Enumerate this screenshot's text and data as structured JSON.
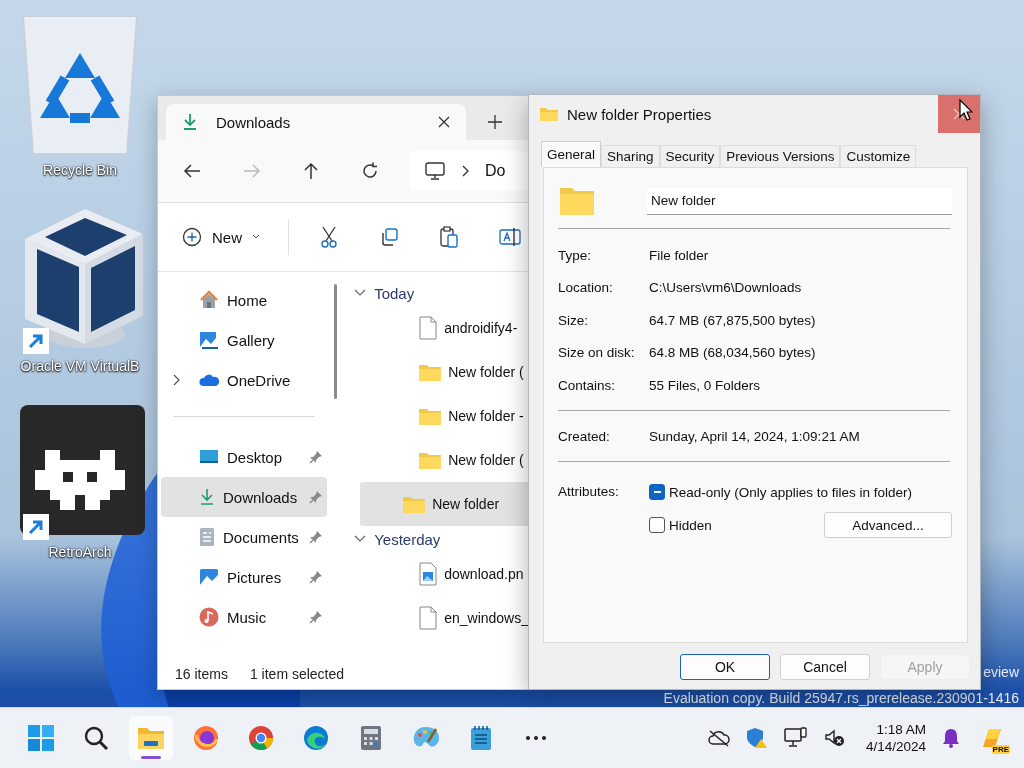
{
  "desktop_icons": [
    {
      "label": "Recycle Bin",
      "kind": "recycle",
      "shortcut": false
    },
    {
      "label": "Oracle VM VirtualB",
      "kind": "virtualbox",
      "shortcut": true
    },
    {
      "label": "RetroArch",
      "kind": "retroarch",
      "shortcut": true
    }
  ],
  "explorer": {
    "tab": {
      "title": "Downloads"
    },
    "address": {
      "crumb": "Do"
    },
    "toolbar": {
      "new_label": "New"
    },
    "sidebar": [
      {
        "items": [
          {
            "label": "Home",
            "kind": "home",
            "pinned": false,
            "selected": false,
            "expandable": false
          },
          {
            "label": "Gallery",
            "kind": "gallery",
            "pinned": false,
            "selected": false,
            "expandable": false
          },
          {
            "label": "OneDrive",
            "kind": "onedrive",
            "pinned": false,
            "selected": false,
            "expandable": true
          }
        ]
      },
      {
        "items": [
          {
            "label": "Desktop",
            "kind": "desktop",
            "pinned": true,
            "selected": false,
            "expandable": false
          },
          {
            "label": "Downloads",
            "kind": "downloads",
            "pinned": true,
            "selected": true,
            "expandable": false
          },
          {
            "label": "Documents",
            "kind": "documents",
            "pinned": true,
            "selected": false,
            "expandable": false
          },
          {
            "label": "Pictures",
            "kind": "pictures",
            "pinned": true,
            "selected": false,
            "expandable": false
          },
          {
            "label": "Music",
            "kind": "music",
            "pinned": true,
            "selected": false,
            "expandable": false
          }
        ]
      }
    ],
    "groups": [
      {
        "label": "Today",
        "expanded": true,
        "items": [
          {
            "name": "androidify4-",
            "kind": "file",
            "selected": false
          },
          {
            "name": "New folder (",
            "kind": "folder",
            "selected": false
          },
          {
            "name": "New folder -",
            "kind": "folder",
            "selected": false
          },
          {
            "name": "New folder (",
            "kind": "folder",
            "selected": false
          },
          {
            "name": "New folder",
            "kind": "folder",
            "selected": true
          }
        ]
      },
      {
        "label": "Yesterday",
        "expanded": true,
        "items": [
          {
            "name": "download.pn",
            "kind": "image",
            "selected": false
          },
          {
            "name": "en_windows_",
            "kind": "file",
            "selected": false
          }
        ]
      }
    ],
    "status": {
      "count": "16 items",
      "selection": "1 item selected"
    }
  },
  "properties": {
    "title": "New folder Properties",
    "tabs": [
      {
        "label": "General",
        "selected": true
      },
      {
        "label": "Sharing",
        "selected": false
      },
      {
        "label": "Security",
        "selected": false
      },
      {
        "label": "Previous Versions",
        "selected": false
      },
      {
        "label": "Customize",
        "selected": false
      }
    ],
    "name_value": "New folder",
    "sections": [
      [
        {
          "label": "Type:",
          "value": "File folder"
        },
        {
          "label": "Location:",
          "value": "C:\\Users\\vm6\\Downloads"
        },
        {
          "label": "Size:",
          "value": "64.7 MB (67,875,500 bytes)"
        },
        {
          "label": "Size on disk:",
          "value": "64.8 MB (68,034,560 bytes)"
        },
        {
          "label": "Contains:",
          "value": "55 Files, 0 Folders"
        }
      ],
      [
        {
          "label": "Created:",
          "value": "Sunday, April 14, 2024, 1:09:21 AM"
        }
      ]
    ],
    "attributes": {
      "label": "Attributes:",
      "checks": [
        {
          "label": "Read-only (Only applies to files in folder)",
          "checked": true,
          "indeterminate": true
        },
        {
          "label": "Hidden",
          "checked": false,
          "indeterminate": false
        }
      ],
      "advanced": "Advanced..."
    },
    "buttons": [
      {
        "label": "OK",
        "kind": "default"
      },
      {
        "label": "Cancel",
        "kind": "normal"
      },
      {
        "label": "Apply",
        "kind": "disabled"
      }
    ]
  },
  "watermark": [
    "eview",
    "Evaluation copy. Build 25947.rs_prerelease.230901-1416"
  ],
  "taskbar": {
    "apps": [
      {
        "kind": "start",
        "active": false
      },
      {
        "kind": "search",
        "active": false
      },
      {
        "kind": "explorer",
        "active": true
      },
      {
        "kind": "firefox",
        "active": false
      },
      {
        "kind": "chrome",
        "active": false
      },
      {
        "kind": "edge",
        "active": false
      },
      {
        "kind": "calculator",
        "active": false
      },
      {
        "kind": "paint",
        "active": false
      },
      {
        "kind": "notepad",
        "active": false
      },
      {
        "kind": "more",
        "active": false
      }
    ],
    "clock": {
      "time": "1:18 AM",
      "date": "4/14/2024"
    },
    "copilot_badge": "PRE"
  }
}
